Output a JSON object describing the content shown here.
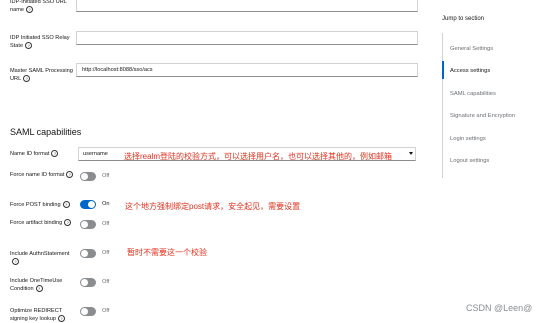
{
  "form": {
    "idp_initiated_name_label": "IDP-Initiated SSO URL name",
    "idp_relay_state_label": "IDP Initiated SSO Relay State",
    "master_saml_label": "Master SAML Processing URL",
    "master_saml_value": "http://localhost:8088/sso/acs"
  },
  "saml": {
    "title": "SAML capabilities",
    "name_id_format_label": "Name ID format",
    "name_id_format_value": "username",
    "force_name_id_label": "Force name ID format",
    "force_post_label": "Force POST binding",
    "force_artifact_label": "Force artifact binding",
    "include_authn_label": "Include AuthnStatement",
    "include_onetime_label": "Include OneTimeUse Condition",
    "optimize_redirect_label": "Optimize REDIRECT signing key lookup",
    "off_text": "Off",
    "on_text": "On",
    "toggles": {
      "force_name_id": false,
      "force_post": true,
      "force_artifact": false,
      "include_authn": false,
      "include_onetime": false,
      "optimize_redirect": false
    }
  },
  "annotations": {
    "name_id": "选择realm登陆的校验方式，可以选择用户名，也可以选择其他的，例如邮箱",
    "force_post": "这个地方强制绑定post请求，安全起见，需要设置",
    "authn": "暂时不需要这一个校验"
  },
  "jump": {
    "title": "Jump to section",
    "items": [
      "General Settings",
      "Access settings",
      "SAML capabilities",
      "Signature and Encryption",
      "Login settings",
      "Logout settings"
    ],
    "active_index": 1
  },
  "watermark": "CSDN @Leen@",
  "colors": {
    "accent": "#0066cc",
    "annotation": "#e0301e"
  }
}
